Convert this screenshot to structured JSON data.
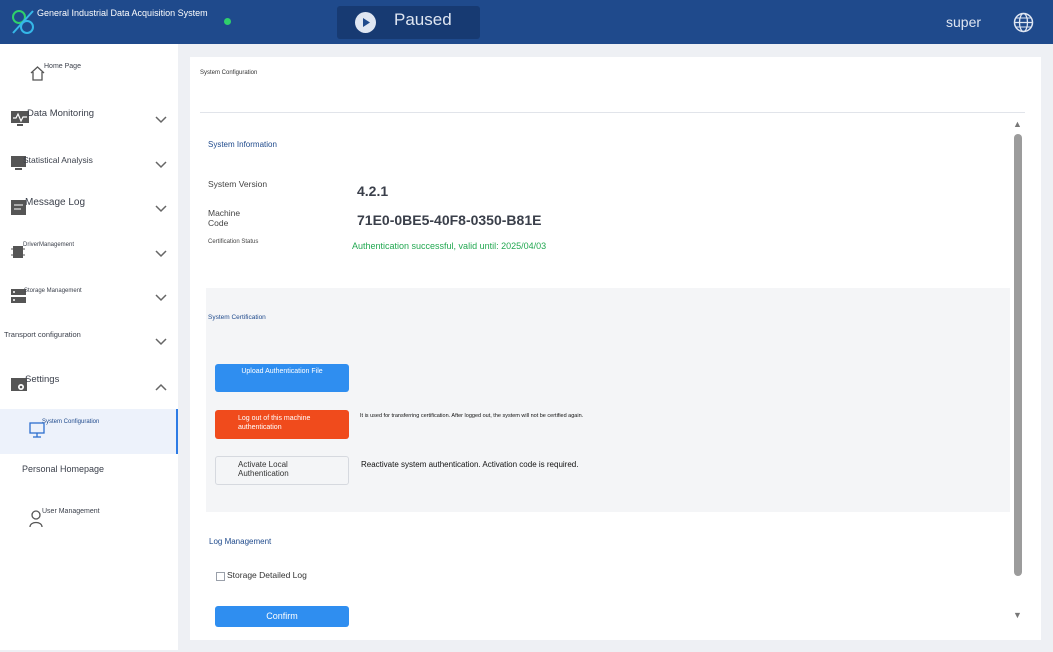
{
  "header": {
    "app_title": "General Industrial Data Acquisition System",
    "run_status": "Paused",
    "user": "super",
    "icons": {
      "logo": "app-logo",
      "play": "play-icon",
      "language": "globe-icon"
    },
    "status_color": "#2fd06b"
  },
  "sidebar": {
    "items": [
      {
        "label": "Home Page",
        "icon": "home-icon"
      },
      {
        "label": "Data Monitoring",
        "icon": "monitor-icon"
      },
      {
        "label": "Statistical Analysis",
        "icon": "chart-icon"
      },
      {
        "label": "Message Log",
        "icon": "message-icon"
      },
      {
        "label": "DriverManagement",
        "icon": "chip-icon"
      },
      {
        "label": "Storage Management",
        "icon": "storage-icon"
      },
      {
        "label": "Transport configuration",
        "icon": ""
      },
      {
        "label": "Settings",
        "icon": "settings-icon"
      },
      {
        "label": "System Configuration",
        "icon": "config-icon"
      },
      {
        "label": "Personal Homepage",
        "icon": ""
      },
      {
        "label": "User Management",
        "icon": "user-icon"
      }
    ]
  },
  "main": {
    "breadcrumb": "System Configuration",
    "system_info": {
      "title": "System Information",
      "version_label": "System Version",
      "version_value": "4.2.1",
      "machine_label_1": "Machine",
      "machine_label_2": "Code",
      "machine_value": "71E0-0BE5-40F8-0350-B81E",
      "cert_status_label": "Certification Status",
      "cert_status_value": "Authentication successful, valid until: 2025/04/03"
    },
    "certification": {
      "title": "System Certification",
      "upload_label": "Upload Authentication File",
      "logout_label_1": "Log out of this machine",
      "logout_label_2": "authentication",
      "logout_desc": "It is used for transferring certification. After logged out, the system will not be certified again.",
      "activate_label_1": "Activate Local",
      "activate_label_2": "Authentication",
      "activate_desc": "Reactivate system authentication. Activation code is required."
    },
    "log_management": {
      "title": "Log Management",
      "storage_detailed_log": "Storage Detailed Log",
      "confirm_label": "Confirm"
    }
  },
  "colors": {
    "topbar": "#1f4a8c",
    "primary": "#2f8ef0",
    "danger": "#f04b1c",
    "success": "#22a851"
  }
}
